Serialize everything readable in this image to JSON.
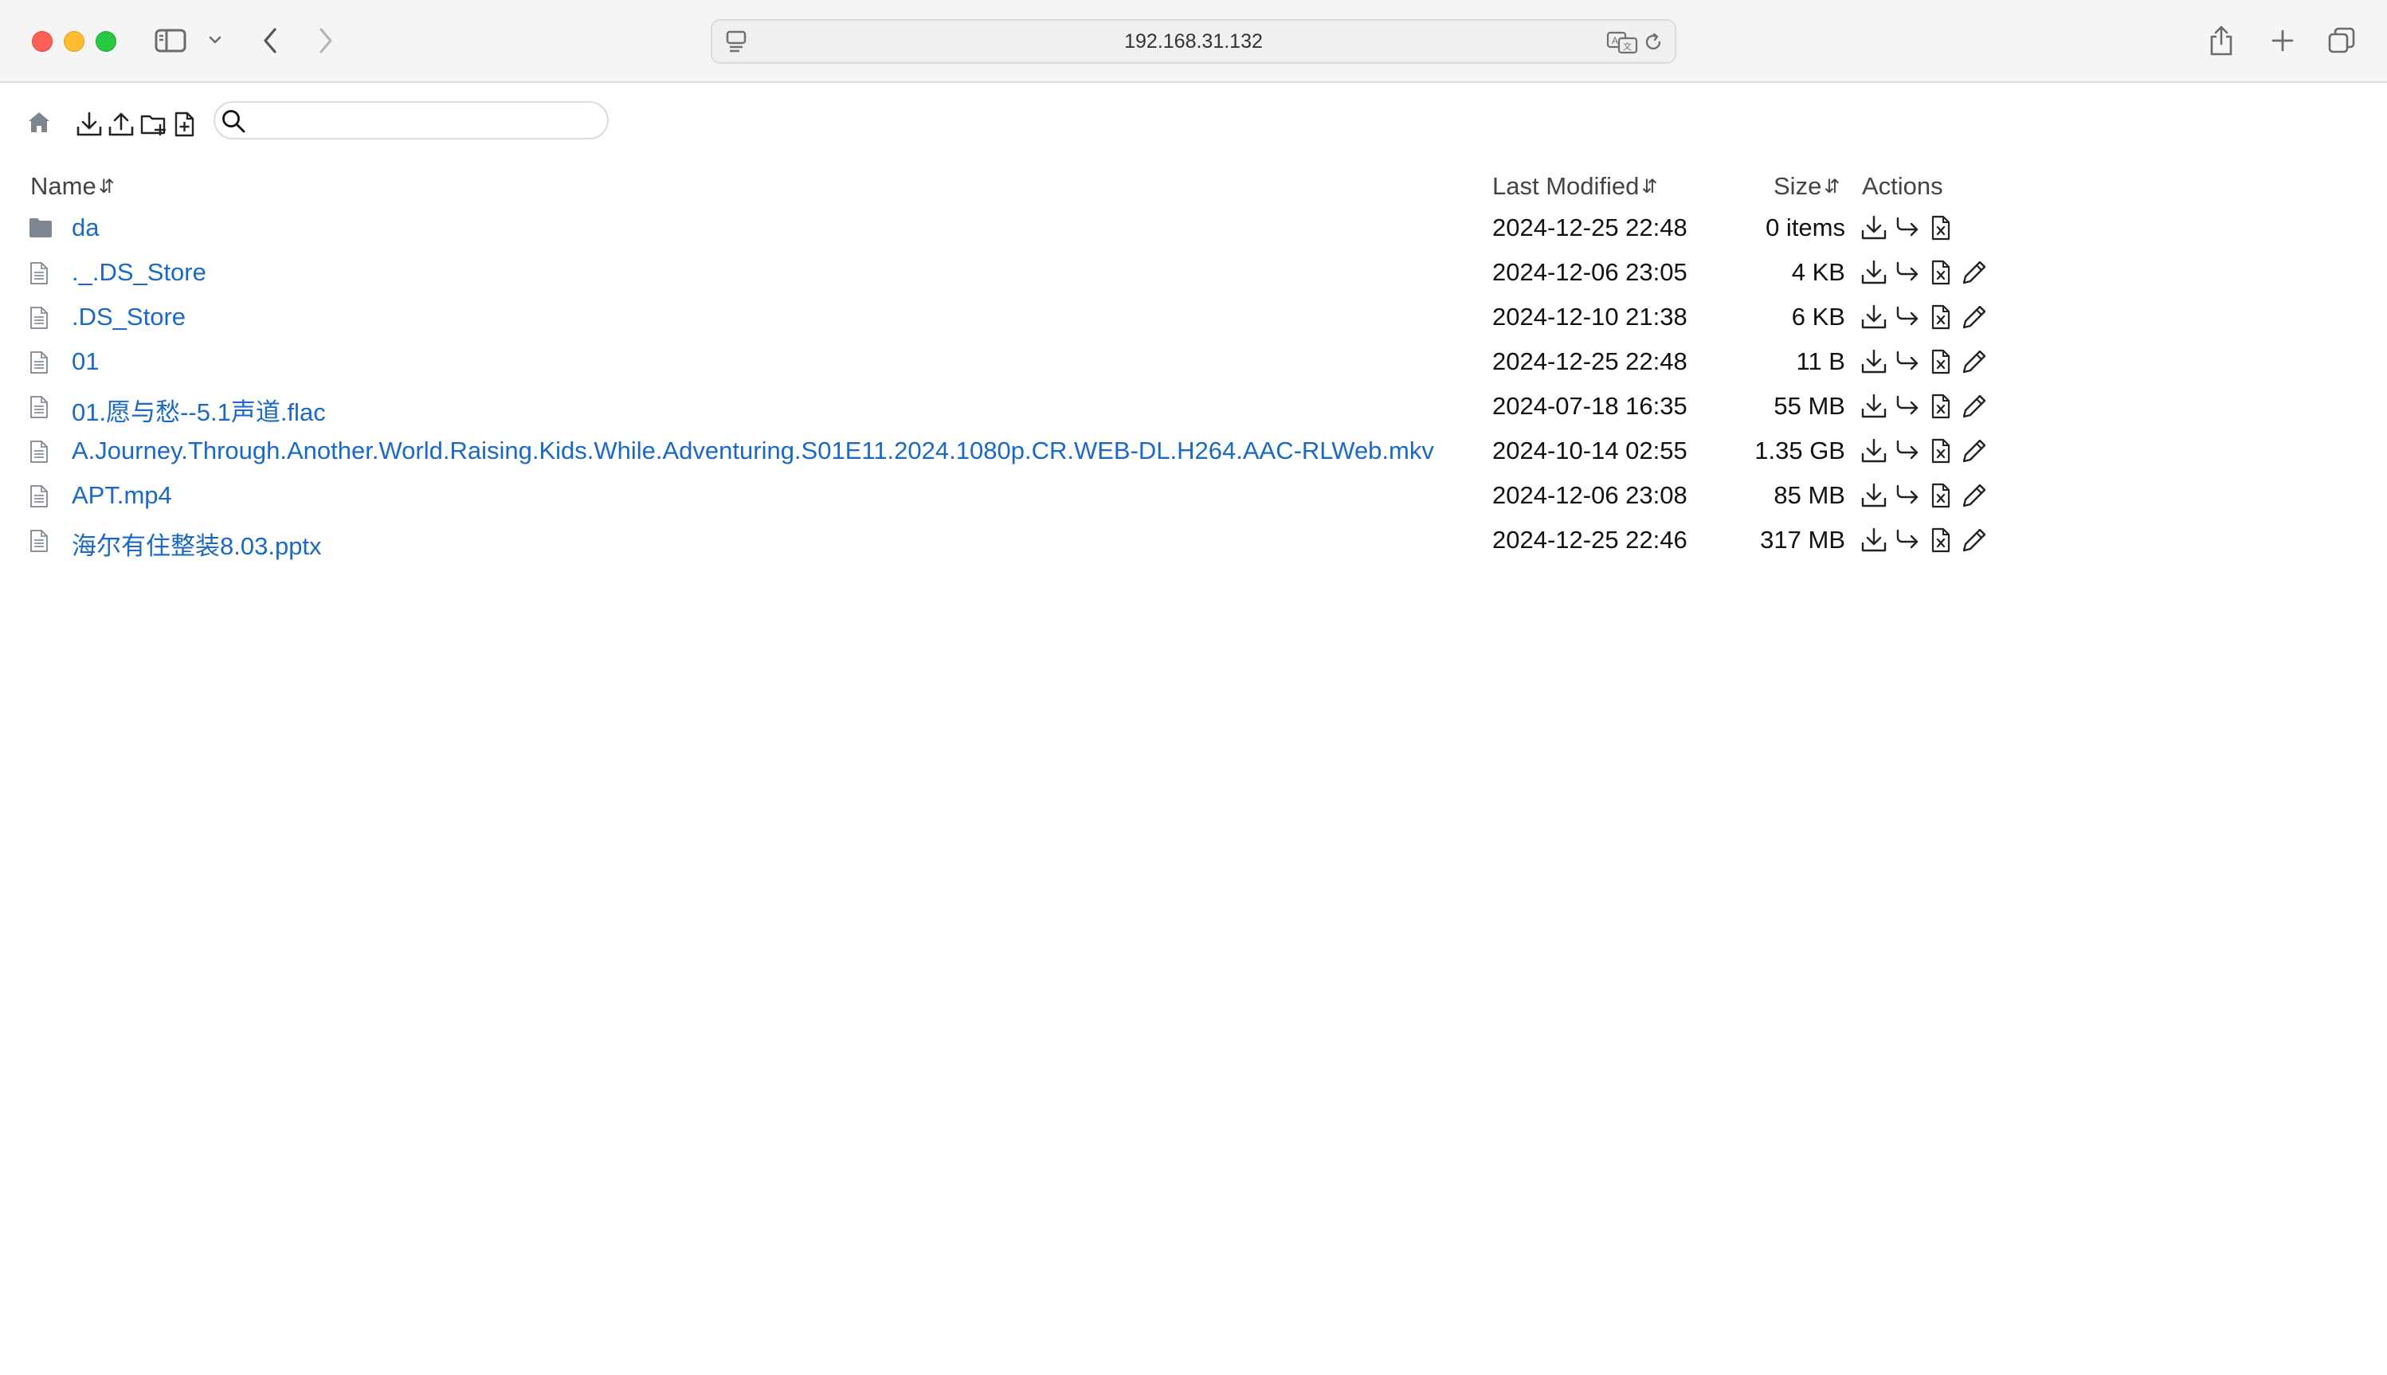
{
  "browser": {
    "url": "192.168.31.132"
  },
  "toolbar": {
    "search": {
      "placeholder": "",
      "value": ""
    }
  },
  "table": {
    "headers": {
      "name": "Name",
      "modified": "Last Modified",
      "size": "Size",
      "actions": "Actions"
    },
    "sort_glyph": "⇵",
    "rows": [
      {
        "type": "folder",
        "name": "da",
        "modified": "2024-12-25 22:48",
        "size": "0 items",
        "editable": false
      },
      {
        "type": "file",
        "name": "._.DS_Store",
        "modified": "2024-12-06 23:05",
        "size": "4 KB",
        "editable": true
      },
      {
        "type": "file",
        "name": ".DS_Store",
        "modified": "2024-12-10 21:38",
        "size": "6 KB",
        "editable": true
      },
      {
        "type": "file",
        "name": "01",
        "modified": "2024-12-25 22:48",
        "size": "11 B",
        "editable": true
      },
      {
        "type": "file",
        "name": "01.愿与愁--5.1声道.flac",
        "modified": "2024-07-18 16:35",
        "size": "55 MB",
        "editable": true
      },
      {
        "type": "file",
        "name": "A.Journey.Through.Another.World.Raising.Kids.While.Adventuring.S01E11.2024.1080p.CR.WEB-DL.H264.AAC-RLWeb.mkv",
        "modified": "2024-10-14 02:55",
        "size": "1.35 GB",
        "editable": true
      },
      {
        "type": "file",
        "name": "APT.mp4",
        "modified": "2024-12-06 23:08",
        "size": "85 MB",
        "editable": true
      },
      {
        "type": "file",
        "name": "海尔有住整装8.03.pptx",
        "modified": "2024-12-25 22:46",
        "size": "317 MB",
        "editable": true
      }
    ]
  },
  "colors": {
    "link": "#1a69c7",
    "text": "#111111",
    "header": "#444444",
    "icon_gray": "#7d8591",
    "traffic_close": "#fe5f57",
    "traffic_minimize": "#febc2e",
    "traffic_maximize": "#28c840"
  }
}
